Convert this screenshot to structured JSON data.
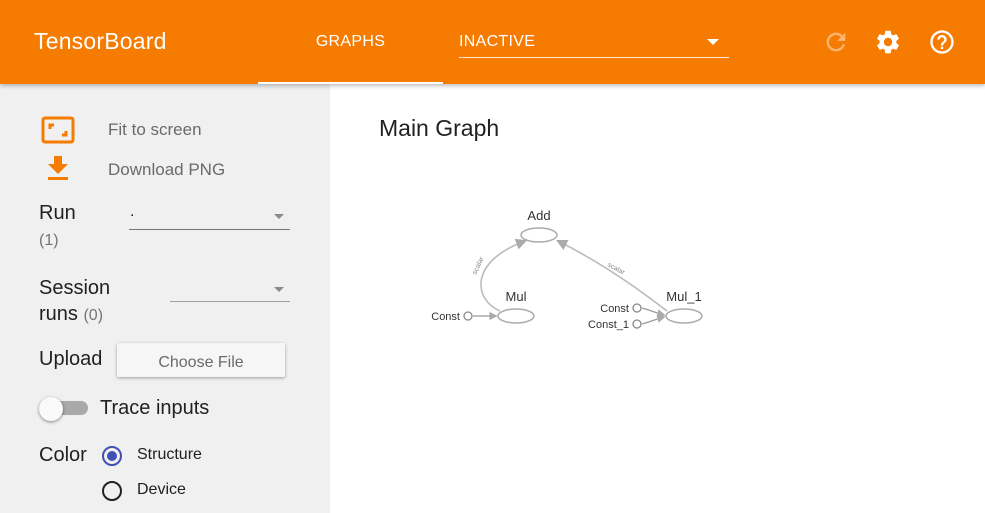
{
  "header": {
    "app_title": "TensorBoard",
    "tab_label": "GRAPHS",
    "plugin_select_value": "INACTIVE",
    "icons": [
      "refresh-icon",
      "settings-icon",
      "help-icon"
    ],
    "accent_color": "#f57c00"
  },
  "sidebar": {
    "fit_to_screen": "Fit to screen",
    "download_png": "Download PNG",
    "run_label": "Run",
    "run_count": "(1)",
    "run_value": ".",
    "session_label_line1": "Session",
    "session_label_line2": "runs",
    "session_count": "(0)",
    "session_value": "",
    "upload_label": "Upload",
    "choose_file": "Choose File",
    "trace_inputs": "Trace inputs",
    "trace_inputs_on": false,
    "color_label": "Color",
    "color_options": [
      "Structure",
      "Device"
    ],
    "color_selected": "Structure"
  },
  "main": {
    "title": "Main Graph",
    "nodes": {
      "add": "Add",
      "mul": "Mul",
      "mul_1": "Mul_1",
      "const_a": "Const",
      "const_b": "Const",
      "const_1": "Const_1"
    },
    "edge_label": "scalar"
  }
}
